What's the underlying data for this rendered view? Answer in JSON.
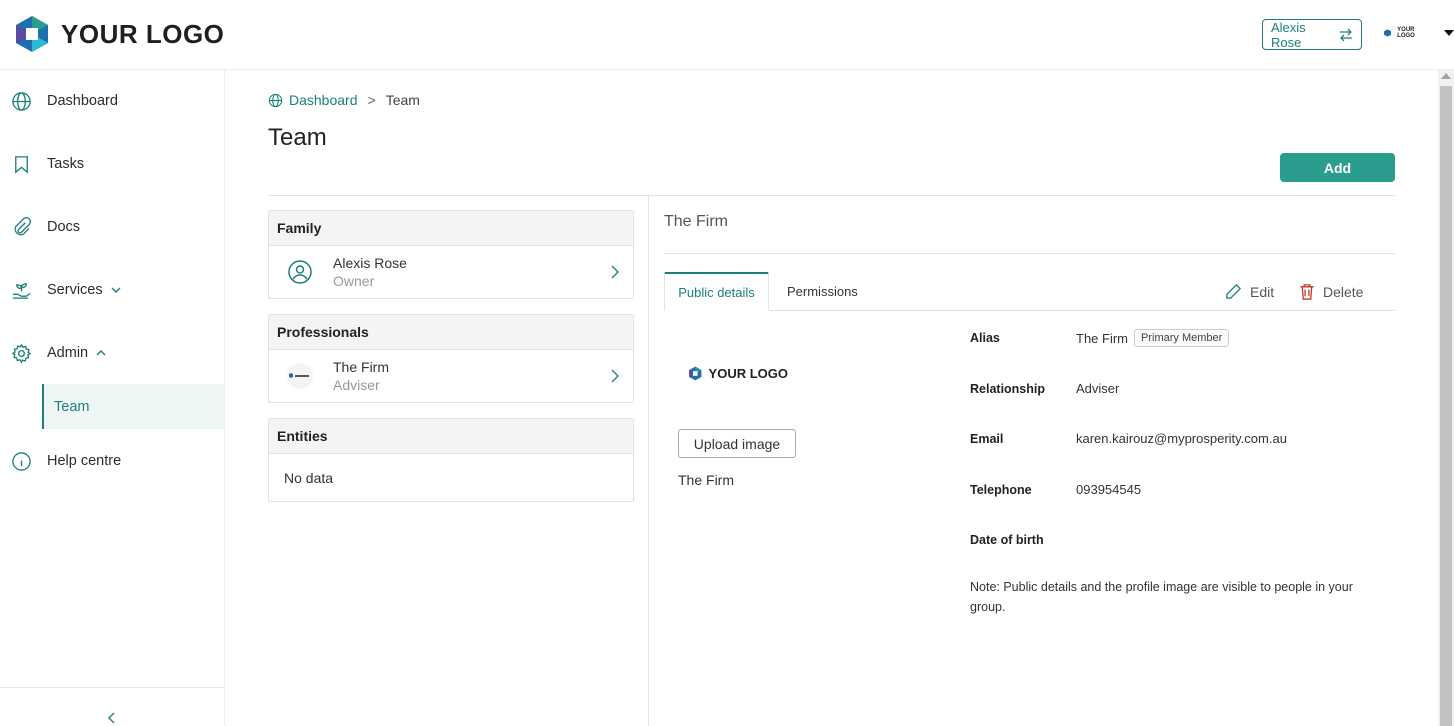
{
  "header": {
    "logo_text": "YOUR LOGO",
    "user_switch_label": "Alexis Rose",
    "mini_logo_text": "YOUR LOGO"
  },
  "sidebar": {
    "items": [
      {
        "label": "Dashboard",
        "icon": "globe-icon"
      },
      {
        "label": "Tasks",
        "icon": "bookmark-icon"
      },
      {
        "label": "Docs",
        "icon": "paperclip-icon"
      },
      {
        "label": "Services",
        "icon": "plant-hand-icon"
      },
      {
        "label": "Admin",
        "icon": "gear-icon"
      },
      {
        "label": "Help centre",
        "icon": "info-icon"
      }
    ],
    "sub_item": "Team"
  },
  "breadcrumb": {
    "root": "Dashboard",
    "separator": ">",
    "current": "Team"
  },
  "page": {
    "title": "Team",
    "add_label": "Add"
  },
  "groups": {
    "family": {
      "title": "Family",
      "members": [
        {
          "name": "Alexis Rose",
          "role": "Owner"
        }
      ]
    },
    "professionals": {
      "title": "Professionals",
      "members": [
        {
          "name": "The Firm",
          "role": "Adviser"
        }
      ]
    },
    "entities": {
      "title": "Entities",
      "empty_text": "No data"
    }
  },
  "detail": {
    "title": "The Firm",
    "tabs": [
      "Public details",
      "Permissions"
    ],
    "edit_label": "Edit",
    "delete_label": "Delete",
    "logo_text": "YOUR LOGO",
    "upload_label": "Upload image",
    "display_name": "The Firm",
    "fields": [
      {
        "label": "Alias",
        "value": "The Firm",
        "badge": "Primary Member"
      },
      {
        "label": "Relationship",
        "value": "Adviser"
      },
      {
        "label": "Email",
        "value": "karen.kairouz@myprosperity.com.au"
      },
      {
        "label": "Telephone",
        "value": "093954545"
      },
      {
        "label": "Date of birth",
        "value": ""
      }
    ],
    "note": "Note: Public details and the profile image are visible to people in your group."
  },
  "colors": {
    "accent": "#1d7f7d",
    "button": "#2a9d8f",
    "danger": "#c0392b"
  }
}
